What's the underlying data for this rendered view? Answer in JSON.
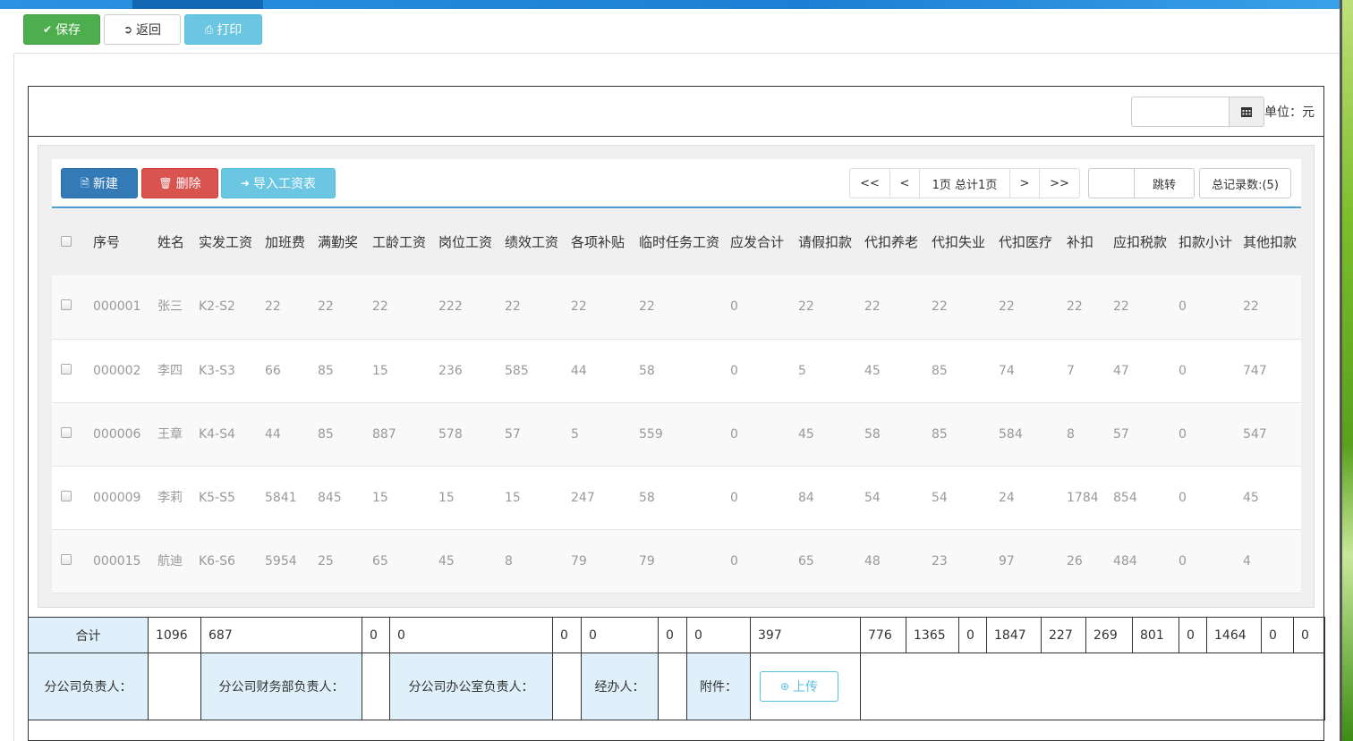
{
  "toolbar": {
    "save": "保存",
    "back": "返回",
    "print": "打印"
  },
  "header": {
    "date_value": "",
    "unit": "单位：元"
  },
  "actions": {
    "new": "新建",
    "delete": "删除",
    "import": "导入工资表"
  },
  "pager": {
    "first": "<<",
    "prev": "<",
    "info": "1页 总计1页",
    "next": ">",
    "last": ">>",
    "jump_value": "",
    "jump": "跳转",
    "total": "总记录数:(5)"
  },
  "columns": [
    "序号",
    "姓名",
    "实发工资",
    "加班费",
    "满勤奖",
    "工龄工资",
    "岗位工资",
    "绩效工资",
    "各项补贴",
    "临时任务工资",
    "应发合计",
    "请假扣款",
    "代扣养老",
    "代扣失业",
    "代扣医疗",
    "补扣",
    "应扣税款",
    "扣款小计",
    "其他扣款"
  ],
  "rows": [
    [
      "000001",
      "张三",
      "K2-S2",
      "22",
      "22",
      "22",
      "222",
      "22",
      "22",
      "22",
      "0",
      "22",
      "22",
      "22",
      "22",
      "22",
      "22",
      "0",
      "22"
    ],
    [
      "000002",
      "李四",
      "K3-S3",
      "66",
      "85",
      "15",
      "236",
      "585",
      "44",
      "58",
      "0",
      "5",
      "45",
      "85",
      "74",
      "7",
      "47",
      "0",
      "747"
    ],
    [
      "000006",
      "王章",
      "K4-S4",
      "44",
      "85",
      "887",
      "578",
      "57",
      "5",
      "559",
      "0",
      "45",
      "58",
      "85",
      "584",
      "8",
      "57",
      "0",
      "547"
    ],
    [
      "000009",
      "李莉",
      "K5-S5",
      "5841",
      "845",
      "15",
      "15",
      "15",
      "247",
      "58",
      "0",
      "84",
      "54",
      "54",
      "24",
      "1784",
      "854",
      "0",
      "45"
    ],
    [
      "000015",
      "航迪",
      "K6-S6",
      "5954",
      "25",
      "65",
      "45",
      "8",
      "79",
      "79",
      "0",
      "65",
      "48",
      "23",
      "97",
      "26",
      "484",
      "0",
      "4"
    ]
  ],
  "footer": {
    "total_label": "合计",
    "totals": [
      "1096",
      "687",
      "0",
      "0",
      "0",
      "0",
      "0",
      "0",
      "397",
      "776",
      "1365",
      "0",
      "1847",
      "227",
      "269",
      "801",
      "0",
      "1464",
      "0",
      "0"
    ],
    "sign": {
      "branch_head": "分公司负责人：",
      "finance_head": "分公司财务部负责人：",
      "office_head": "分公司办公室负责人：",
      "handler": "经办人：",
      "attachment": "附件：",
      "upload": "上传"
    }
  }
}
